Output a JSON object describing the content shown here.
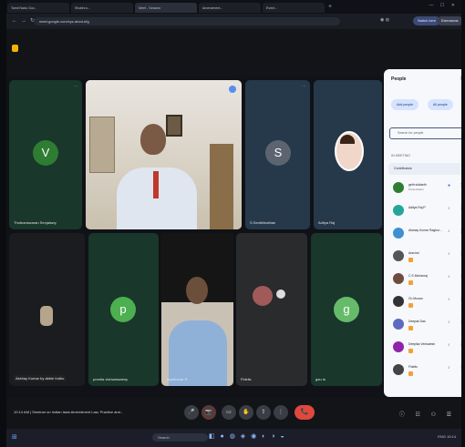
{
  "browser": {
    "tabs": [
      {
        "title": "Tamil Nadu Gov...",
        "active": false
      },
      {
        "title": "Shubhra...",
        "active": false
      },
      {
        "title": "Meet - Session",
        "active": true
      },
      {
        "title": "Amendment...",
        "active": false
      },
      {
        "title": "Event...",
        "active": false
      }
    ],
    "url": "meet.google.com/xyz-abcd-efg",
    "btn_join": "Switch here",
    "btn_ext": "Extensions",
    "new_tab": "+",
    "window_controls": "— ☐ ✕"
  },
  "icons": {
    "back": "←",
    "forward": "→",
    "reload": "↻",
    "mic": "🎤",
    "cam": "📷",
    "hand": "✋",
    "more": "⋮",
    "leave": "📞"
  },
  "tiles": [
    {
      "kind": "avatar",
      "letter": "V",
      "name": "Thoteanswaran Senjaiswy",
      "color": "#2e7d32"
    },
    {
      "kind": "video",
      "name": ""
    },
    {
      "kind": "avatar",
      "letter": "S",
      "name": "S.Senthilnathan",
      "color": "#5b6470"
    },
    {
      "kind": "photo",
      "name": "Aditya Raj"
    },
    {
      "kind": "avatar-dark",
      "name": "Akshay Kumar by abbie Indhu"
    },
    {
      "kind": "avatar",
      "letter": "P",
      "name": "pranita vishwaswamy",
      "color": "#4caf50"
    },
    {
      "kind": "video2",
      "name": "Jayakumar R"
    },
    {
      "kind": "photo2",
      "name": "Fidelis"
    },
    {
      "kind": "avatar",
      "letter": "g",
      "name": "gau la",
      "color": "#66bb6a"
    }
  ],
  "people": {
    "title": "People",
    "add_people": "Add people",
    "all_meetings": "All people",
    "search_placeholder": "Search for people",
    "in_meeting": "IN MEETING",
    "contributors": "Contributors",
    "participants": [
      {
        "name": "geth siddarth",
        "sub": "Presentation",
        "color": "#2e7d32"
      },
      {
        "name": "Aditya Raj P.",
        "sub": "",
        "color": "#26a69a"
      },
      {
        "name": "Akshay Kumar Raghur...",
        "sub": "",
        "color": "#3f8fd2"
      },
      {
        "name": "Aravind",
        "sub": "",
        "color": "#555"
      },
      {
        "name": "C.S Mohanraj",
        "sub": "",
        "color": "#6d4c41"
      },
      {
        "name": "Ch Moosa",
        "sub": "",
        "color": "#333"
      },
      {
        "name": "Deepak Das",
        "sub": "",
        "color": "#5c6bc0"
      },
      {
        "name": "Deepika Venkatesh",
        "sub": "",
        "color": "#8e24aa"
      },
      {
        "name": "Fidelis",
        "sub": "",
        "color": "#444"
      }
    ]
  },
  "meeting": {
    "info": "10:14 AM | Seminar on Indian laws Amendment Law, Practice and...",
    "leave_label": "📞"
  },
  "taskbar": {
    "start": "⊞",
    "search": "Search",
    "apps": "◧ ● ◍ ◈ ◉ ◐ ◑ ◒",
    "tray": "ENG  10:14"
  }
}
